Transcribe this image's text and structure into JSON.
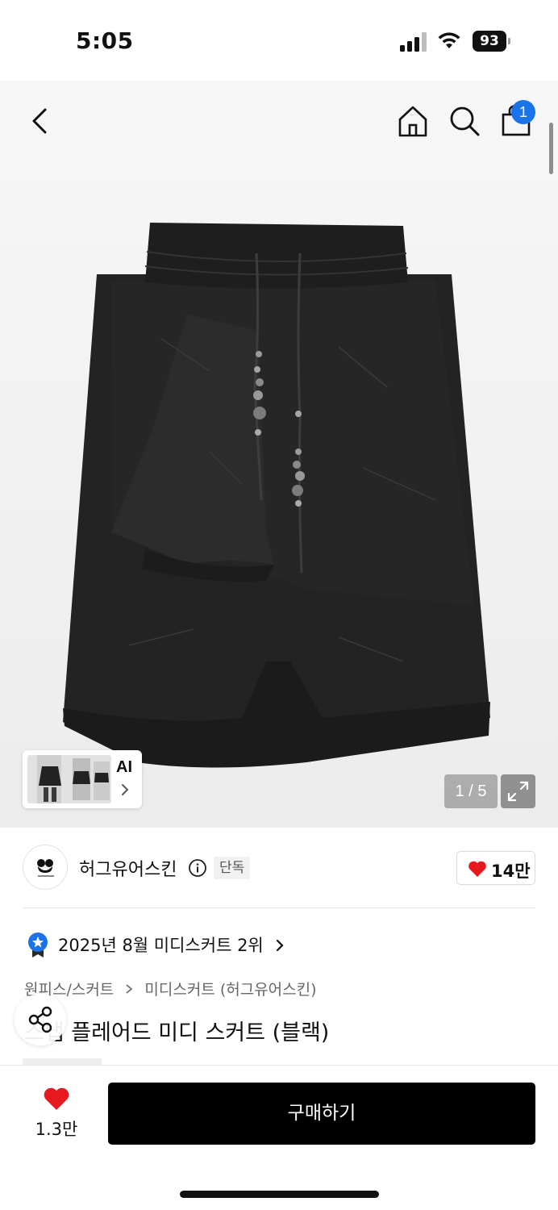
{
  "status_bar": {
    "time": "5:05",
    "battery": "93"
  },
  "header": {
    "cart_count": "1",
    "icons": [
      "back-icon",
      "home-icon",
      "search-icon",
      "shopping-bag-icon"
    ]
  },
  "gallery": {
    "ai_label": "AI",
    "page_counter": "1 / 5"
  },
  "brand": {
    "name": "허그유어스킨",
    "exclusive_badge": "단독",
    "like_count": "14만"
  },
  "ranking": {
    "text": "2025년 8월 미디스커트 2위"
  },
  "breadcrumb": {
    "category": "원피스/스커트",
    "subcategory": "미디스커트 (허그유어스킨)"
  },
  "product": {
    "title": "스냅 플레어드 미디 스커트 (블랙)"
  },
  "bottom_bar": {
    "wish_count": "1.3만",
    "buy_label": "구매하기"
  },
  "colors": {
    "accent_blue": "#1a73e8",
    "heart_red": "#e8191e",
    "buy_button": "#000000"
  }
}
